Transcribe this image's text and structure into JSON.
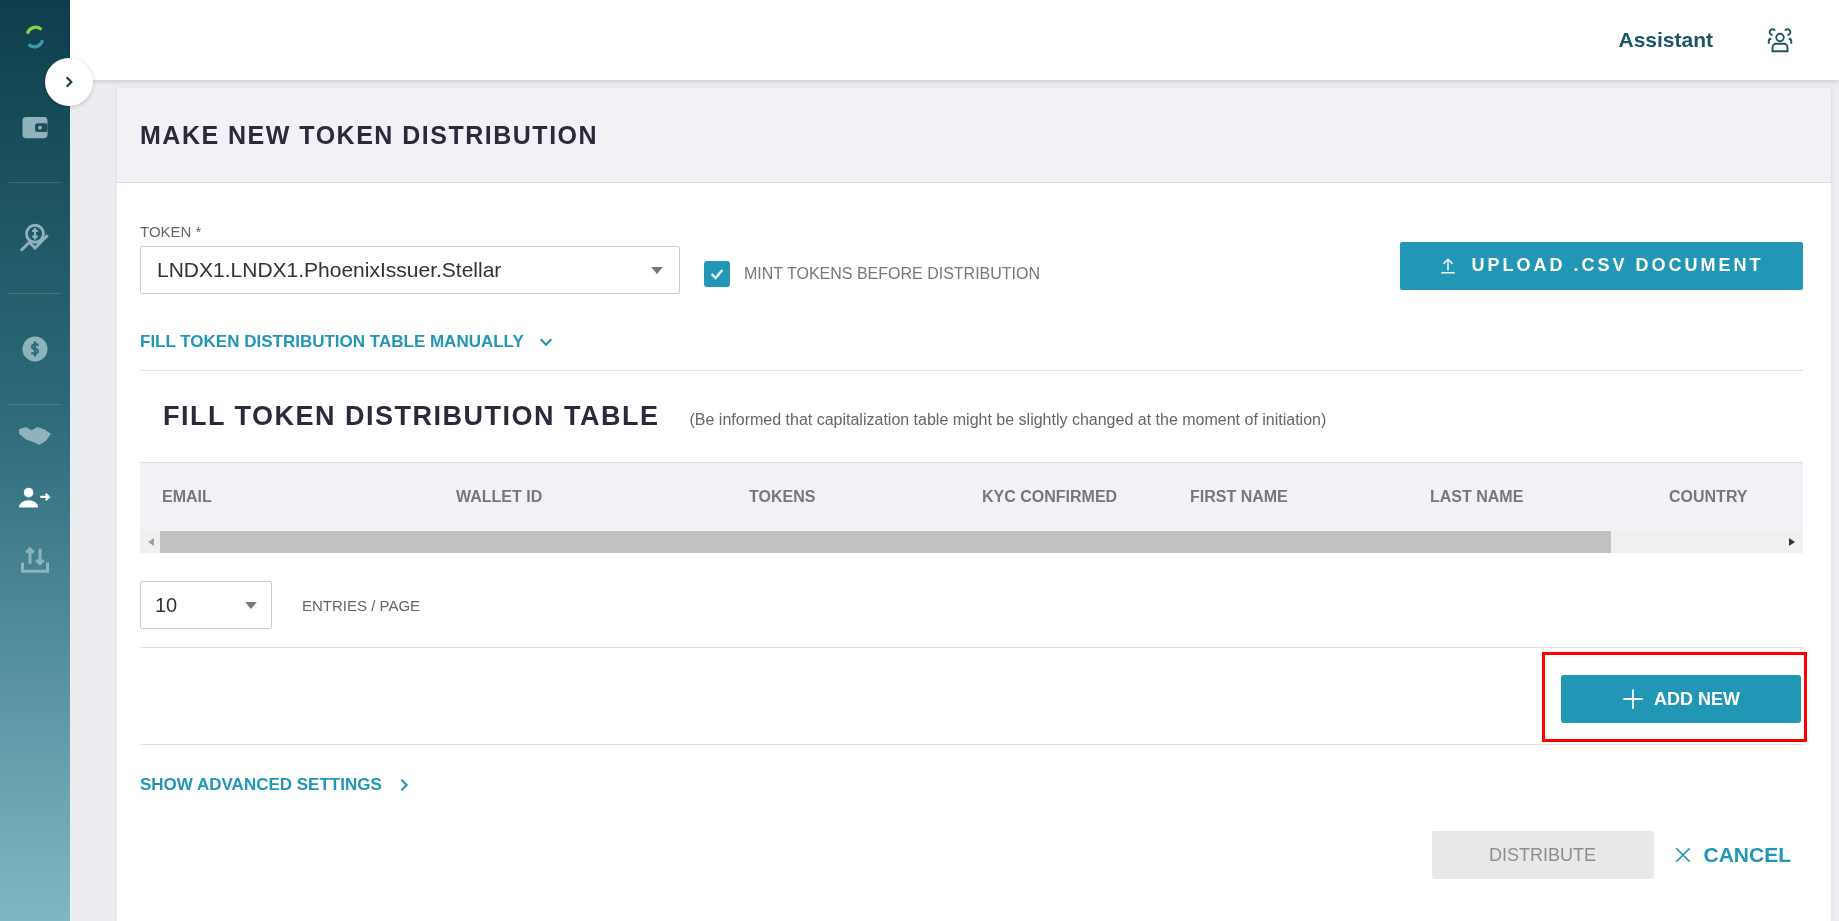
{
  "sidebar": {
    "items": [
      {
        "selected": false
      },
      {
        "selected": false
      },
      {
        "selected": false
      },
      {
        "selected": false
      },
      {
        "selected": true
      },
      {
        "selected": false
      }
    ]
  },
  "topbar": {
    "assistant": "Assistant"
  },
  "card": {
    "title": "MAKE NEW TOKEN DISTRIBUTION",
    "token": {
      "label": "TOKEN *",
      "value": "LNDX1.LNDX1.PhoenixIssuer.Stellar"
    },
    "mint": {
      "label": "MINT TOKENS BEFORE DISTRIBUTION",
      "checked": true
    },
    "upload_button": "UPLOAD .CSV DOCUMENT",
    "manual_toggle": {
      "label": "FILL TOKEN DISTRIBUTION TABLE MANUALLY",
      "expanded": true
    },
    "table": {
      "title": "FILL TOKEN DISTRIBUTION TABLE",
      "note": "(Be informed that capitalization table might be slightly changed at the moment of initiation)",
      "columns": [
        "EMAIL",
        "WALLET ID",
        "TOKENS",
        "KYC CONFIRMED",
        "FIRST NAME",
        "LAST NAME",
        "COUNTRY"
      ]
    },
    "entries": {
      "value": "10",
      "label": "ENTRIES / PAGE"
    },
    "add_button": {
      "label": "ADD NEW",
      "highlighted": true
    },
    "advanced_toggle": {
      "label": "SHOW ADVANCED SETTINGS",
      "expanded": false
    },
    "distribute_button": {
      "label": "DISTRIBUTE",
      "disabled": true
    },
    "cancel_button": "CANCEL"
  }
}
